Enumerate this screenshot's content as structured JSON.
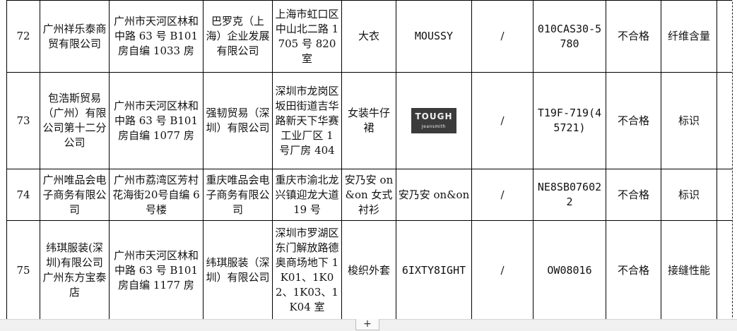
{
  "rows": [
    {
      "no": "72",
      "seller": "广州祥乐泰商贸有限公司",
      "seller_addr": "广州市天河区林和中路 63 号 B101 房自编 1033 房",
      "producer": "巴罗克（上海）企业发展有限公司",
      "producer_addr": "上海市虹口区中山北二路 1705 号 820 室",
      "product": "大衣",
      "brand": "MOUSSY",
      "spec": "/",
      "batch": "010CAS30-5780",
      "result": "不合格",
      "item": "纤维含量"
    },
    {
      "no": "73",
      "seller": "包浩斯贸易（广州）有限公司第十二分公司",
      "seller_addr": "广州市天河区林和中路 63 号 B101 房自编 1077 房",
      "producer": "强韧贸易（深圳）有限公司",
      "producer_addr": "深圳市龙岗区坂田街道吉华路新天下华赛工业厂区 1 号厂房 404",
      "product": "女装牛仔裙",
      "brand_logo_big": "TOUGH",
      "brand_logo_small": "Jeansmith",
      "spec": "/",
      "batch": "T19F-719(45721)",
      "result": "不合格",
      "item": "标识"
    },
    {
      "no": "74",
      "seller": "广州唯品会电子商务有限公司",
      "seller_addr": "广州市荔湾区芳村花海街20号自编 6 号楼",
      "producer": "重庆唯品会电子商务有限公司",
      "producer_addr": "重庆市渝北龙兴镇迎龙大道 19 号",
      "product": "安乃安 on&on 女式衬衫",
      "brand": "安乃安 on&on",
      "spec": "/",
      "batch": "NE8SB076022",
      "result": "不合格",
      "item": "标识"
    },
    {
      "no": "75",
      "seller": "纬琪服装(深圳)有限公司广州东方宝泰店",
      "seller_addr": "广州市天河区林和中路 63 号 B101 房自编 1177 房",
      "producer": "纬琪服装（深圳）有限公司",
      "producer_addr": "深圳市罗湖区东门解放路德奥商场地下 1K01、1K02、1K03、1K04 室",
      "product": "梭织外套",
      "brand": "6IXTY8IGHT",
      "spec": "/",
      "batch": "OW08016",
      "result": "不合格",
      "item": "接缝性能"
    }
  ],
  "tabbar": {
    "add_sheet_label": "+"
  }
}
